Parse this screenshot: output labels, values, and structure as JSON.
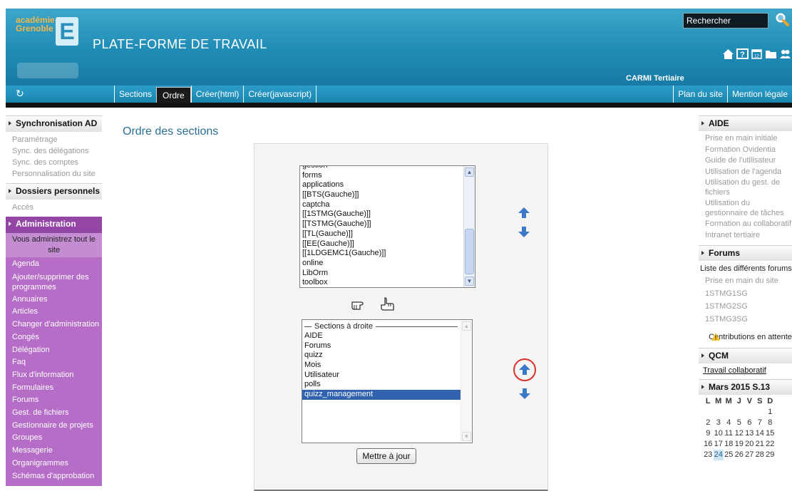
{
  "header": {
    "logo_line1": "académie",
    "logo_line2": "Grenoble",
    "logo_letter": "E",
    "platform_title": "PLATE-FORME DE TRAVAIL",
    "search_placeholder": "Rechercher",
    "user_name": "CARMI Tertiaire",
    "icons": [
      "home-icon",
      "help-icon",
      "calendar-icon",
      "folder-icon",
      "users-icon",
      "settings-icon",
      "messages-icon",
      "rss-icon",
      "power-icon"
    ]
  },
  "nav": {
    "left": [
      "Sections",
      "Ordre",
      "Créer(html)",
      "Créer(javascript)"
    ],
    "active": "Ordre",
    "right": [
      "Plan du site",
      "Mention légale"
    ]
  },
  "left_sidebar": {
    "sync": {
      "title": "Synchronisation AD",
      "items": [
        "Paramétrage",
        "Sync. des délégations",
        "Sync. des comptes",
        "Personnalisation du site"
      ]
    },
    "dossiers": {
      "title": "Dossiers personnels",
      "items": [
        "Accès"
      ]
    },
    "admin": {
      "title": "Administration",
      "note": "Vous administrez tout le site",
      "items": [
        "Agenda",
        "Ajouter/supprimer des programmes",
        "Annuaires",
        "Articles",
        "Changer d'administration",
        "Congés",
        "Délégation",
        "Faq",
        "Flux d'information",
        "Formulaires",
        "Forums",
        "Gest. de fichiers",
        "Gestionnaire de projets",
        "Groupes",
        "Messagerie",
        "Organigrammes",
        "Schémas d'approbation"
      ]
    }
  },
  "main": {
    "title": "Ordre des sections",
    "left_list": {
      "items": [
        "gestion",
        "forms",
        "applications",
        "[[BTS(Gauche)]]",
        "captcha",
        "[[1STMG(Gauche)]]",
        "[[TSTMG(Gauche)]]",
        "[[TL(Gauche)]]",
        "[[EE(Gauche)]]",
        "[[1LDGEMC1(Gauche)]]",
        "online",
        "LibOrm",
        "toolbox"
      ]
    },
    "right_list": {
      "group_label": "Sections à droite",
      "items": [
        "AIDE",
        "Forums",
        "quizz",
        "Mois",
        "Utilisateur",
        "polls",
        "quizz_management"
      ],
      "selected": "quizz_management"
    },
    "update_button": "Mettre à jour"
  },
  "right_sidebar": {
    "aide": {
      "title": "AIDE",
      "items": [
        "Prise en main initiale",
        "Formation Ovidentia",
        "Guide de l'utilisateur",
        "Utilisation de l'agenda",
        "Utilisation du gest. de fichiers",
        "Utilisation du gestionnaire de tâches",
        "Formation au collaboratif",
        "Intranet tertiaire"
      ]
    },
    "forums": {
      "title": "Forums",
      "subtitle": "Liste des différents forums",
      "items": [
        "Prise en main du site",
        "1STMG1SG",
        "1STMG2SG",
        "1STMG3SG"
      ],
      "pending": "Contributions en attente"
    },
    "qcm": {
      "title": "QCM",
      "link": "Travail collaboratif"
    },
    "calendar": {
      "title": "Mars 2015  S.13",
      "weekdays": [
        "L",
        "M",
        "M",
        "J",
        "V",
        "S",
        "D"
      ],
      "rows": [
        [
          "",
          "",
          "",
          "",
          "",
          "",
          "1"
        ],
        [
          "2",
          "3",
          "4",
          "5",
          "6",
          "7",
          "8"
        ],
        [
          "9",
          "10",
          "11",
          "12",
          "13",
          "14",
          "15"
        ],
        [
          "16",
          "17",
          "18",
          "19",
          "20",
          "21",
          "22"
        ],
        [
          "23",
          "24",
          "25",
          "26",
          "27",
          "28",
          "29"
        ]
      ],
      "today": "24"
    }
  }
}
